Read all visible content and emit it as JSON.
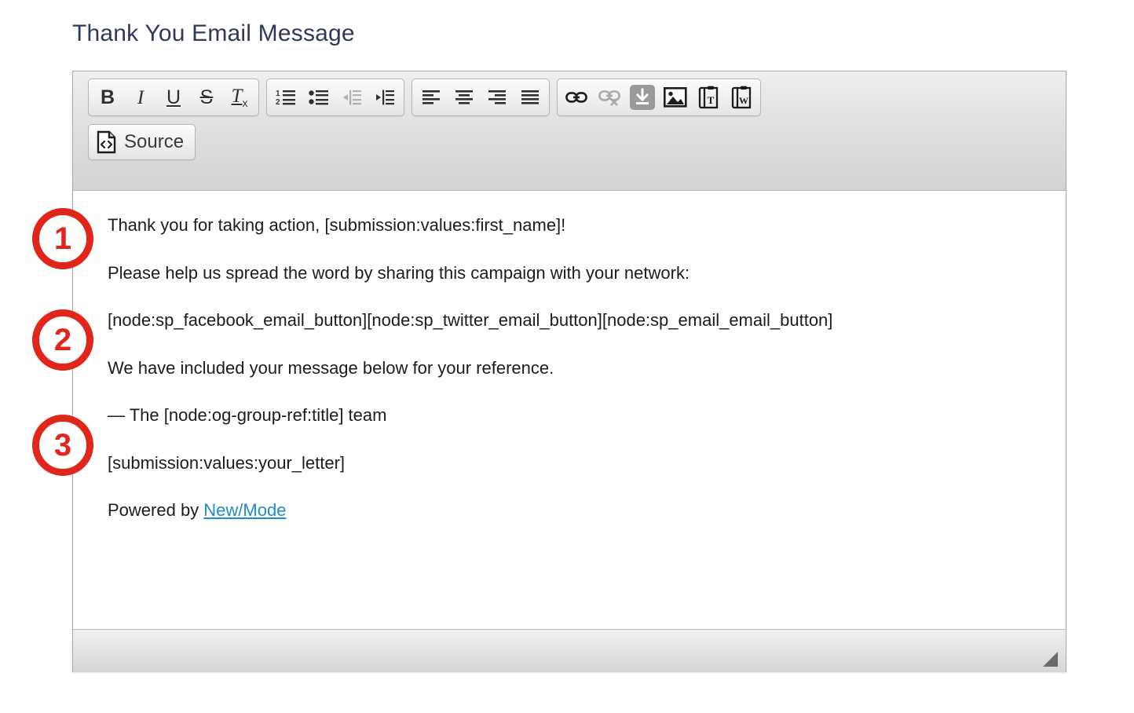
{
  "page": {
    "title": "Thank You Email Message"
  },
  "editor": {
    "toolbar": {
      "rows": [
        {
          "groups": [
            {
              "name": "text-styles",
              "buttons": [
                {
                  "name": "bold-button",
                  "icon": "bold-icon",
                  "label": "B",
                  "disabled": false
                },
                {
                  "name": "italic-button",
                  "icon": "italic-icon",
                  "label": "I",
                  "disabled": false
                },
                {
                  "name": "underline-button",
                  "icon": "underline-icon",
                  "label": "U",
                  "disabled": false
                },
                {
                  "name": "strikethrough-button",
                  "icon": "strikethrough-icon",
                  "label": "S",
                  "disabled": false
                },
                {
                  "name": "remove-format-button",
                  "icon": "remove-format-icon",
                  "label": "Tx",
                  "disabled": false
                }
              ]
            },
            {
              "name": "lists-indent",
              "buttons": [
                {
                  "name": "numbered-list-button",
                  "icon": "numbered-list-icon",
                  "label": "",
                  "disabled": false
                },
                {
                  "name": "bulleted-list-button",
                  "icon": "bulleted-list-icon",
                  "label": "",
                  "disabled": false
                },
                {
                  "name": "decrease-indent-button",
                  "icon": "decrease-indent-icon",
                  "label": "",
                  "disabled": true
                },
                {
                  "name": "increase-indent-button",
                  "icon": "increase-indent-icon",
                  "label": "",
                  "disabled": false
                }
              ]
            },
            {
              "name": "alignment",
              "buttons": [
                {
                  "name": "align-left-button",
                  "icon": "align-left-icon",
                  "label": "",
                  "disabled": false
                },
                {
                  "name": "align-center-button",
                  "icon": "align-center-icon",
                  "label": "",
                  "disabled": false
                },
                {
                  "name": "align-right-button",
                  "icon": "align-right-icon",
                  "label": "",
                  "disabled": false
                },
                {
                  "name": "align-justify-button",
                  "icon": "align-justify-icon",
                  "label": "",
                  "disabled": false
                }
              ]
            },
            {
              "name": "insert",
              "buttons": [
                {
                  "name": "link-button",
                  "icon": "link-icon",
                  "label": "",
                  "disabled": false
                },
                {
                  "name": "unlink-button",
                  "icon": "unlink-icon",
                  "label": "",
                  "disabled": true
                },
                {
                  "name": "insert-template-button",
                  "icon": "download-icon",
                  "label": "",
                  "disabled": false
                },
                {
                  "name": "insert-image-button",
                  "icon": "image-icon",
                  "label": "",
                  "disabled": false
                },
                {
                  "name": "paste-as-text-button",
                  "icon": "paste-text-icon",
                  "label": "",
                  "disabled": false
                },
                {
                  "name": "paste-from-word-button",
                  "icon": "paste-word-icon",
                  "label": "",
                  "disabled": false
                }
              ]
            }
          ]
        },
        {
          "groups": [
            {
              "name": "source",
              "buttons": [
                {
                  "name": "source-button",
                  "icon": "source-code-icon",
                  "label": "Source",
                  "disabled": false
                }
              ]
            }
          ]
        }
      ]
    },
    "body": {
      "paragraphs": [
        {
          "text": "Thank you for taking action, [submission:values:first_name]!"
        },
        {
          "text": "Please help us spread the word by sharing this campaign with your network:"
        },
        {
          "text": "[node:sp_facebook_email_button][node:sp_twitter_email_button][node:sp_email_email_button]"
        },
        {
          "text": "We have included your message below for your reference."
        },
        {
          "text": "— The [node:og-group-ref:title] team"
        },
        {
          "text": "[submission:values:your_letter]"
        }
      ],
      "footer": {
        "prefix": "Powered by ",
        "link_text": "New/Mode"
      }
    },
    "statusbar": {
      "resize_handle": "resize-grip"
    }
  },
  "annotations": [
    {
      "name": "annotation-badge-1",
      "label": "1"
    },
    {
      "name": "annotation-badge-2",
      "label": "2"
    },
    {
      "name": "annotation-badge-3",
      "label": "3"
    }
  ],
  "colors": {
    "title": "#2e3a59",
    "annotation_red": "#e0251b",
    "link_blue": "#1f8ace",
    "body_text": "#1c1c1c"
  }
}
